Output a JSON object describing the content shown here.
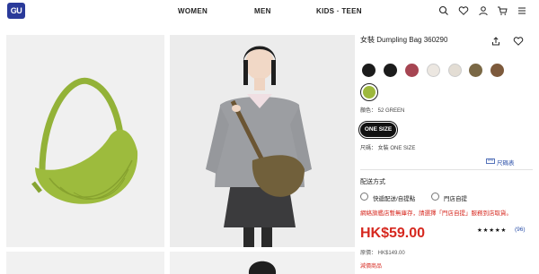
{
  "header": {
    "logo": "GU",
    "nav": [
      "WOMEN",
      "MEN",
      "KIDS · TEEN"
    ]
  },
  "product": {
    "title": "女裝 Dumpling Bag 360290",
    "color_label": "顏色： 52 GREEN",
    "size_value": "ONE SIZE",
    "size_label": "尺碼： 女裝 ONE SIZE",
    "size_chart": "尺碼表",
    "colors": [
      "#1c1c1c",
      "#1c1c1c",
      "#a64552",
      "#ece7e1",
      "#e3ddd4",
      "#7a6845",
      "#7d5a3c",
      "#9db83c"
    ],
    "selected_color": "#9db83c"
  },
  "delivery": {
    "heading": "配送方式",
    "options": [
      "快遞配送/自提點",
      "門店自提"
    ],
    "warning": "網絡旗艦店暫無庫存，請選擇「門店自提」服務到店取貨。"
  },
  "pricing": {
    "price": "HK$59.00",
    "stars": "★★★★★",
    "rating_count": "(96)",
    "original_price": "原價： HK$149.00",
    "promo": "減價商品"
  }
}
